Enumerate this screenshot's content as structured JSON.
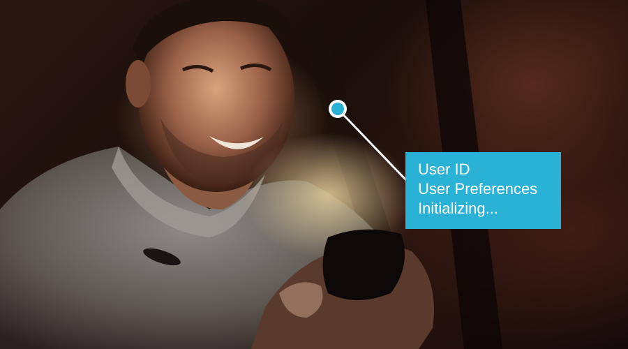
{
  "callout": {
    "lines": [
      "User ID",
      "User Preferences",
      "Initializing..."
    ],
    "box_color": "#29b1d6",
    "dot_color": "#29b1d6"
  }
}
